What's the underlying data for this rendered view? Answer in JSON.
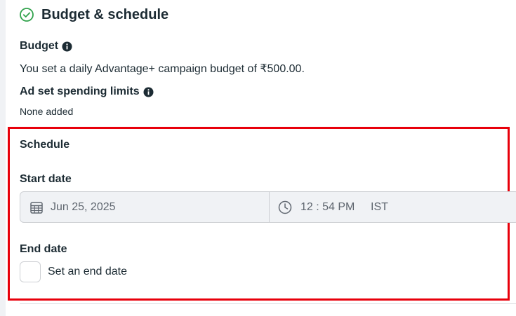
{
  "section": {
    "title": "Budget & schedule",
    "status_icon": "check-circle-icon"
  },
  "budget": {
    "label": "Budget",
    "info_icon": "info-icon",
    "text": "You set a daily Advantage+ campaign budget of ₹500.00."
  },
  "spending_limits": {
    "label": "Ad set spending limits",
    "info_icon": "info-icon",
    "value": "None added"
  },
  "schedule": {
    "title": "Schedule",
    "start_date": {
      "label": "Start date",
      "date_value": "Jun 25, 2025",
      "date_icon": "calendar-icon",
      "time_value": "12 : 54 PM",
      "timezone": "IST",
      "time_icon": "clock-icon"
    },
    "end_date": {
      "label": "End date",
      "checkbox_label": "Set an end date",
      "checked": false
    }
  },
  "colors": {
    "highlight_border": "#e8000b",
    "success_green": "#31a24c",
    "text": "#1c2b33"
  }
}
